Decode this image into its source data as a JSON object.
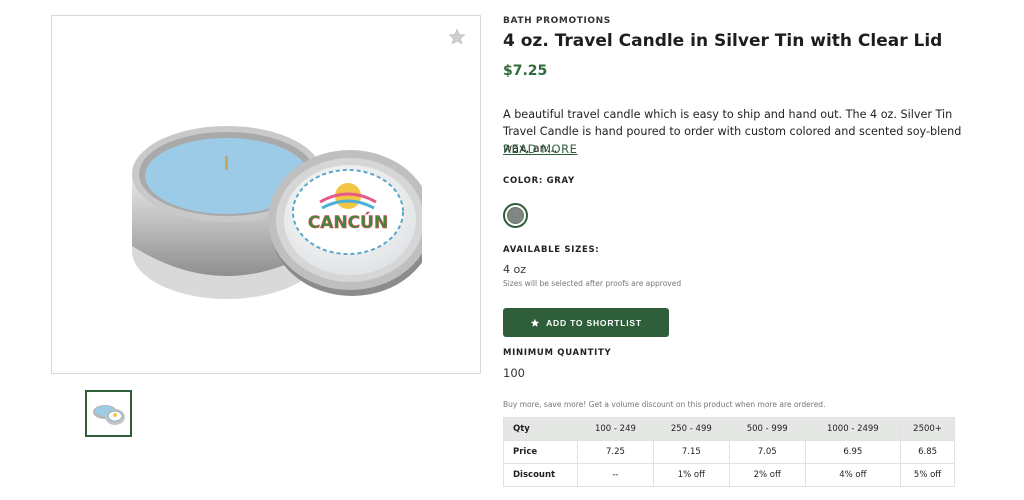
{
  "product": {
    "brand": "BATH PROMOTIONS",
    "title": "4 oz. Travel Candle in Silver Tin with Clear Lid",
    "price": "$7.25",
    "description": "A beautiful travel candle which is easy to ship and hand out. The 4 oz. Silver Tin Travel Candle is hand poured to order with custom colored and scented soy-blend wax, an...",
    "read_more": "READ MORE"
  },
  "color": {
    "label": "COLOR: GRAY",
    "swatch_hex": "#808780"
  },
  "sizes": {
    "label": "AVAILABLE SIZES:",
    "value": "4 oz",
    "note": "Sizes will be selected after proofs are approved"
  },
  "shortlist": {
    "label": "ADD TO SHORTLIST"
  },
  "minimum": {
    "label": "MINIMUM QUANTITY",
    "value": "100"
  },
  "volume": {
    "note": "Buy more, save more! Get a volume discount on this product when more are ordered.",
    "header": [
      "Qty",
      "100 - 249",
      "250 - 499",
      "500 - 999",
      "1000 - 2499",
      "2500+"
    ],
    "price_row": [
      "Price",
      "7.25",
      "7.15",
      "7.05",
      "6.95",
      "6.85"
    ],
    "discount_row": [
      "Discount",
      "--",
      "1% off",
      "2% off",
      "4% off",
      "5% off"
    ]
  },
  "image": {
    "logo_text": "CANCÚN"
  },
  "colors": {
    "accent": "#2f5f3a",
    "price": "#2f6b3a",
    "table_header": "#e4e7e4",
    "wax": "#9ccbe8"
  },
  "icons": {
    "favorite": "star-icon",
    "shortlist": "star-icon"
  }
}
